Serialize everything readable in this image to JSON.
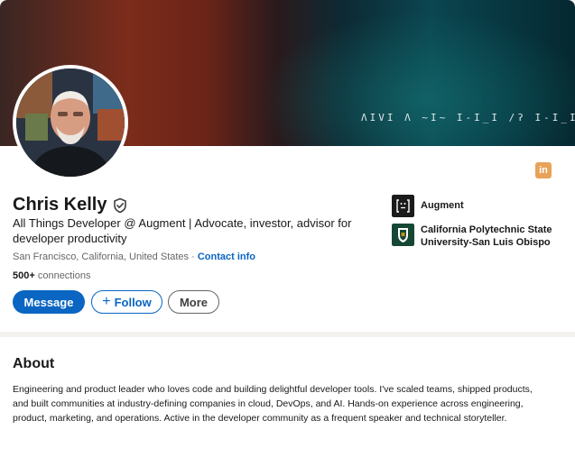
{
  "profile": {
    "banner_text": "ΛΙVΙ Λ ~Ι~ Ι-Ι_Ι /ʔ Ι-Ι_Ι ΙVΙ Λ ΙΝ",
    "name": "Chris Kelly",
    "verified": true,
    "headline": "All Things Developer @ Augment | Advocate, investor, advisor for developer productivity",
    "location": "San Francisco, California, United States",
    "separator": " · ",
    "contact_label": "Contact info",
    "connections_count": "500+",
    "connections_label": " connections",
    "linkedin_icon": "in"
  },
  "actions": {
    "message_label": "Message",
    "follow_label": "Follow",
    "more_label": "More"
  },
  "organizations": [
    {
      "name": "Augment",
      "icon": "augment-logo-icon"
    },
    {
      "name": "California Polytechnic State University-San Luis Obispo",
      "icon": "cal-poly-logo-icon"
    }
  ],
  "about": {
    "title": "About",
    "text": "Engineering and product leader who loves code and building delightful developer tools. I've scaled teams, shipped products, and built communities at industry-defining companies in cloud, DevOps, and AI. Hands-on experience across engineering, product, marketing, and operations. Active in the developer community as a frequent speaker and technical storyteller."
  },
  "colors": {
    "primary": "#0a66c2",
    "muted_text": "#666666",
    "background": "#f4f2ee"
  }
}
